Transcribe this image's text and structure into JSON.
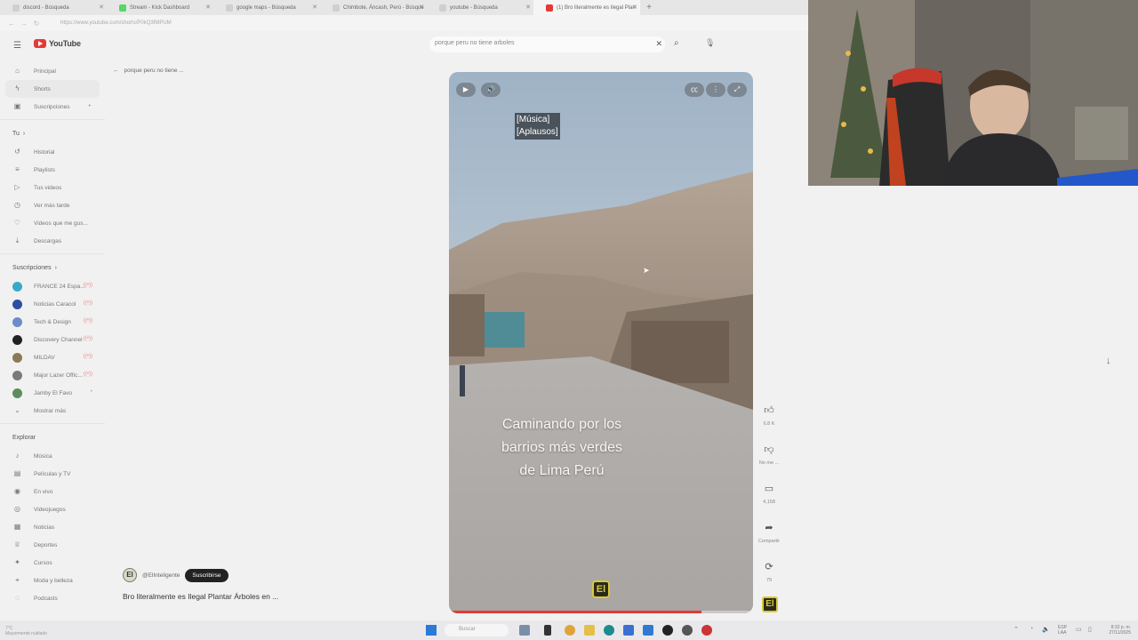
{
  "browser": {
    "tabs": [
      {
        "label": "discord - Búsqueda",
        "fav": ""
      },
      {
        "label": "Stream - Kick Dashboard",
        "fav": "green"
      },
      {
        "label": "google maps - Búsqueda",
        "fav": ""
      },
      {
        "label": "Chimbote, Áncash, Perú - Búsque",
        "fav": ""
      },
      {
        "label": "youtube - Búsqueda",
        "fav": ""
      },
      {
        "label": "(1) Bro literalmente es Ilegal Plan",
        "fav": "red"
      }
    ],
    "new_tab": "+",
    "url": "https://www.youtube.com/shorts/P0kQ3fMPUM"
  },
  "youtube": {
    "logo_text": "YouTube",
    "search_value": "porque peru no tiene arboles",
    "back_label": "porque peru no tiene ..."
  },
  "sidebar": {
    "main": [
      {
        "label": "Principal",
        "icon": "⌂"
      },
      {
        "label": "Shorts",
        "icon": "ϟ"
      },
      {
        "label": "Suscripciones",
        "icon": "▣"
      }
    ],
    "you_header": "Tu",
    "you_items": [
      {
        "label": "Historial",
        "icon": "↺"
      },
      {
        "label": "Playlists",
        "icon": "≡"
      },
      {
        "label": "Tus videos",
        "icon": "▷"
      },
      {
        "label": "Ver más tarde",
        "icon": "◷"
      },
      {
        "label": "Videos que me gus...",
        "icon": "♡"
      },
      {
        "label": "Descargas",
        "icon": "⤓"
      }
    ],
    "subs_header": "Suscripciones",
    "subs": [
      {
        "label": "FRANCE 24 Espa...",
        "color": "#3aa9c9",
        "live": "((•))"
      },
      {
        "label": "Noticias Caracol",
        "color": "#2c4fa3",
        "live": "((•))"
      },
      {
        "label": "Tech & Design",
        "color": "#6b8cc7",
        "live": "((•))"
      },
      {
        "label": "Discovery Channel",
        "color": "#222222",
        "live": "((•))"
      },
      {
        "label": "MILDAV",
        "color": "#8a7a55",
        "live": "((•))"
      },
      {
        "label": "Major Lazer Offic...",
        "color": "#7a7a7a",
        "live": "((•))"
      },
      {
        "label": "Jamby El Favo",
        "color": "#5d8c5d",
        "live": "•"
      }
    ],
    "show_more": "Mostrar más",
    "explore_header": "Explorar",
    "explore": [
      {
        "label": "Música",
        "icon": "♪"
      },
      {
        "label": "Películas y TV",
        "icon": "▤"
      },
      {
        "label": "En vivo",
        "icon": "◉"
      },
      {
        "label": "Videojuegos",
        "icon": "◎"
      },
      {
        "label": "Noticias",
        "icon": "▦"
      },
      {
        "label": "Deportes",
        "icon": "♕"
      },
      {
        "label": "Cursos",
        "icon": "✦"
      },
      {
        "label": "Moda y belleza",
        "icon": "⌖"
      },
      {
        "label": "Podcasts",
        "icon": "◌"
      }
    ]
  },
  "short": {
    "caption_line1": "[Música]",
    "caption_line2": "[Aplausos]",
    "overlay_line1": "Caminando por los",
    "overlay_line2": "barrios más verdes",
    "overlay_line3": "de Lima Perú",
    "watermark": "El",
    "progress": 0.83,
    "channel_handle": "@ElInteligente",
    "subscribe_label": "Suscribirse",
    "title": "Bro literalmente es Ilegal Plantar Árboles en ..."
  },
  "actions": {
    "likes": "6.8 K",
    "dislike": "No me ...",
    "comments": "4,158",
    "share": "Compartir",
    "remix": "79"
  },
  "taskbar": {
    "search_placeholder": "Buscar",
    "weather": "7°C",
    "weather_sub": "Mayormente nublado",
    "lang": "ESP",
    "lang_sub": "LAA",
    "time": "8:32 p. m.",
    "date": "27/11/2025"
  }
}
